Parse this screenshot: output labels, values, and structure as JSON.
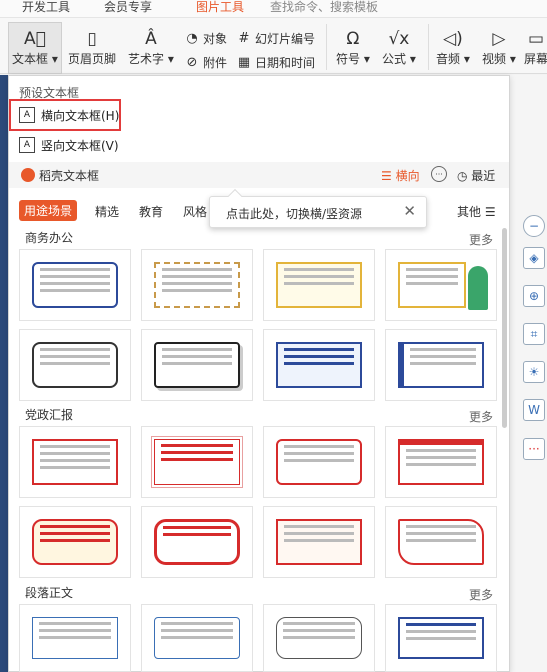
{
  "top_tabs": [
    "开发工具",
    "会员专享",
    "图片工具",
    "查找命令、搜索模板"
  ],
  "ribbon": {
    "textbox": "文本框",
    "header_footer": "页眉页脚",
    "wordart": "艺术字",
    "object": "对象",
    "slide_number": "幻灯片编号",
    "attachment": "附件",
    "date_time": "日期和时间",
    "symbol": "符号",
    "formula": "公式",
    "audio": "音频",
    "video": "视频",
    "screen": "屏幕"
  },
  "panel": {
    "preset_title": "预设文本框",
    "horizontal": "横向文本框(H)",
    "vertical": "竖向文本框(V)",
    "brand_name": "稻壳文本框",
    "direction": "横向",
    "recent": "最近",
    "categories": [
      "用途场景",
      "精选",
      "教育",
      "风格",
      "其他"
    ],
    "tooltip": "点击此处，切换横/竖资源",
    "sections": [
      {
        "title": "商务办公",
        "more": "更多"
      },
      {
        "title": "党政汇报",
        "more": "更多"
      },
      {
        "title": "段落正文",
        "more": "更多"
      }
    ]
  },
  "colors": {
    "accent": "#e8582a",
    "highlight": "#e23b3b",
    "blue": "#2c4a9a",
    "red": "#d62b2b"
  }
}
